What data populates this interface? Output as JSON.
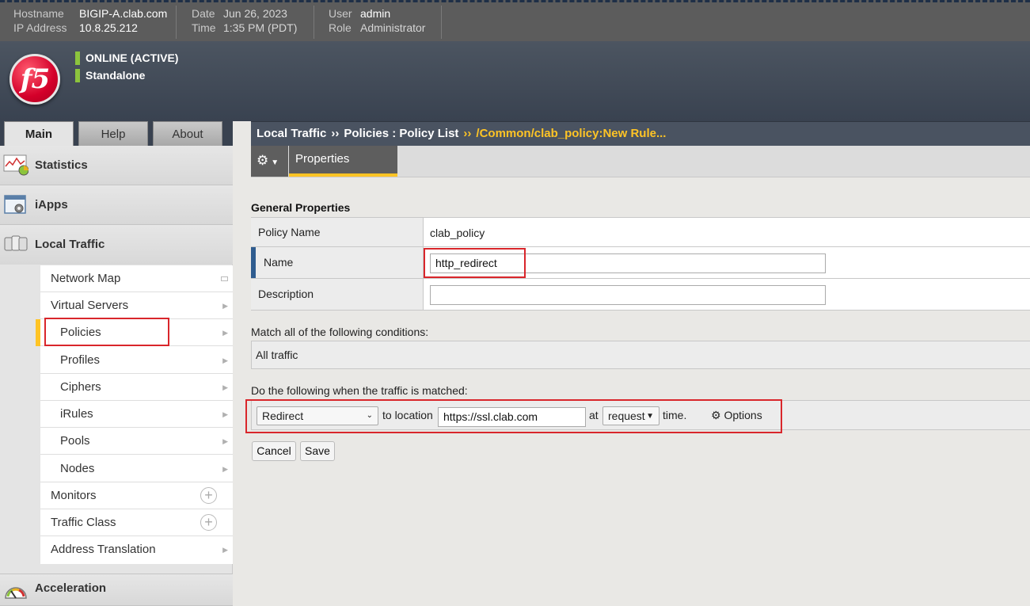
{
  "topbar": {
    "hostname_label": "Hostname",
    "hostname": "BIGIP-A.clab.com",
    "ip_label": "IP Address",
    "ip": "10.8.25.212",
    "date_label": "Date",
    "date": "Jun 26, 2023",
    "time_label": "Time",
    "time": "1:35 PM (PDT)",
    "user_label": "User",
    "user": "admin",
    "role_label": "Role",
    "role": "Administrator"
  },
  "banner": {
    "logo_text": "f5",
    "status_online": "ONLINE (ACTIVE)",
    "status_mode": "Standalone",
    "status_color": "#8cc43d"
  },
  "tabs": [
    {
      "label": "Main",
      "active": true
    },
    {
      "label": "Help",
      "active": false
    },
    {
      "label": "About",
      "active": false
    }
  ],
  "breadcrumb": {
    "part1": "Local Traffic",
    "sep": "››",
    "part2": "Policies : Policy List",
    "current": "/Common/clab_policy:New Rule..."
  },
  "toolbar": {
    "gear_icon": "gear-icon",
    "properties_tab": "Properties"
  },
  "sidebar": {
    "sections": {
      "statistics": "Statistics",
      "iapps": "iApps",
      "local_traffic": "Local Traffic",
      "acceleration": "Acceleration"
    },
    "items": [
      {
        "label": "Network Map"
      },
      {
        "label": "Virtual Servers"
      },
      {
        "label": "Policies"
      },
      {
        "label": "Profiles"
      },
      {
        "label": "Ciphers"
      },
      {
        "label": "iRules"
      },
      {
        "label": "Pools"
      },
      {
        "label": "Nodes"
      },
      {
        "label": "Monitors"
      },
      {
        "label": "Traffic Class"
      },
      {
        "label": "Address Translation"
      }
    ]
  },
  "form": {
    "section_title": "General Properties",
    "policy_name_label": "Policy Name",
    "policy_name_value": "clab_policy",
    "name_label": "Name",
    "name_value": "http_redirect",
    "description_label": "Description",
    "description_value": "",
    "conditions_label": "Match all of the following conditions:",
    "conditions_value": "All traffic",
    "actions_label": "Do the following when the traffic is matched:",
    "action_type": "Redirect",
    "to_location_text": "to location",
    "location_value": "https://ssl.clab.com",
    "at_text": "at",
    "event_value": "request",
    "time_text": "time.",
    "options_label": "Options",
    "cancel_label": "Cancel",
    "save_label": "Save"
  },
  "colors": {
    "accent": "#ffc425",
    "highlight": "#d9262b",
    "required": "#2f5c8f"
  }
}
